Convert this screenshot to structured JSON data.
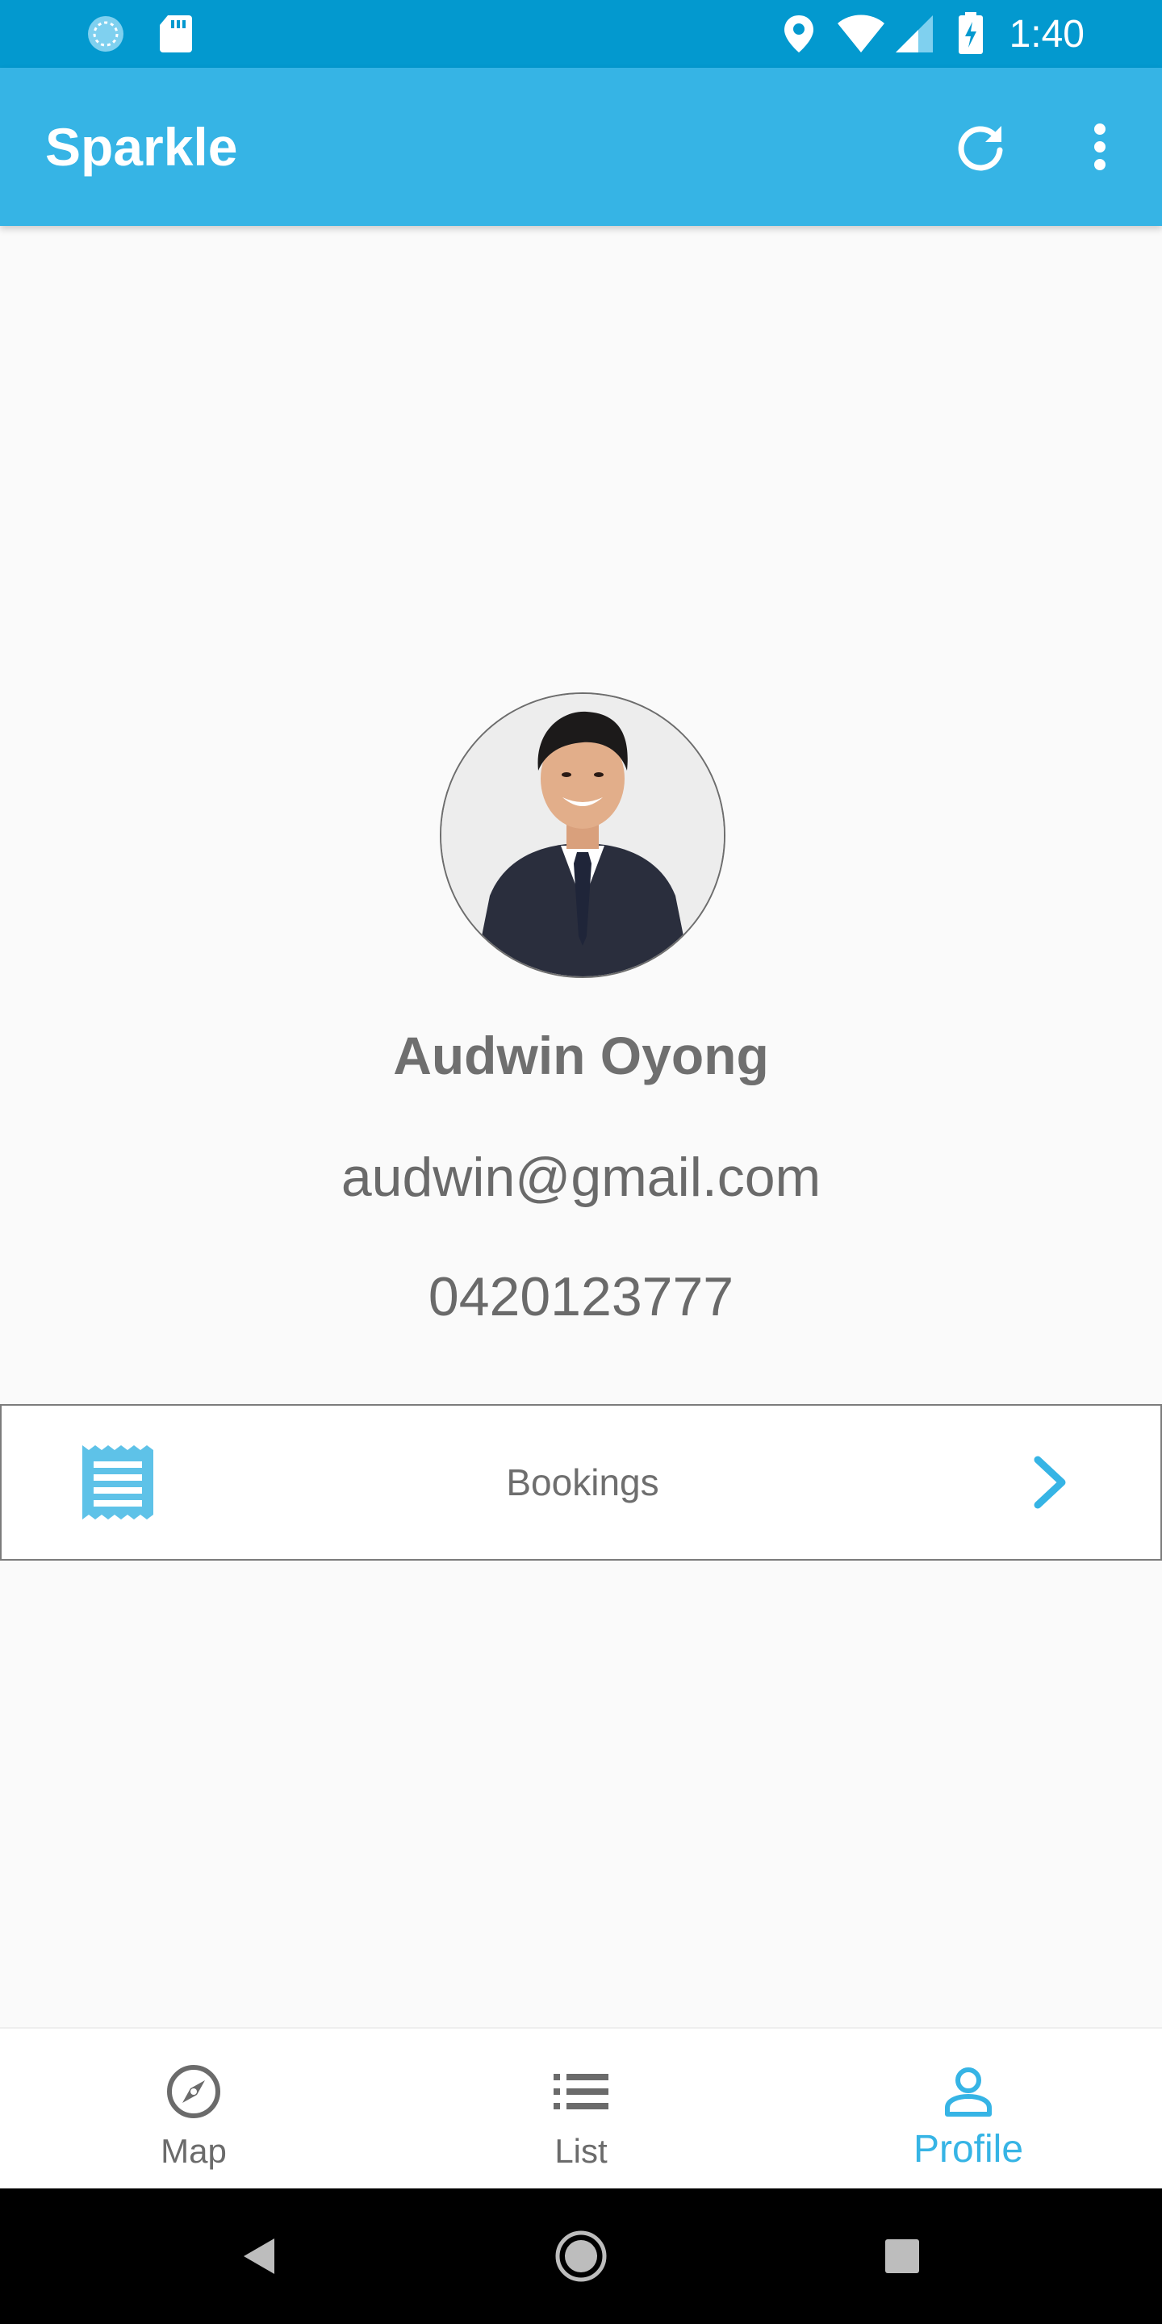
{
  "status_bar": {
    "time": "1:40",
    "left_icons": [
      "sync-icon",
      "sd-card-icon"
    ],
    "right_icons": [
      "location-icon",
      "wifi-icon",
      "signal-icon",
      "battery-charging-icon"
    ]
  },
  "app_bar": {
    "title": "Sparkle",
    "actions": [
      "refresh-icon",
      "more-vert-icon"
    ],
    "color": "#36b4e5"
  },
  "profile": {
    "name": "Audwin Oyong",
    "email": "audwin@gmail.com",
    "phone": "0420123777"
  },
  "bookings": {
    "label": "Bookings",
    "icon": "receipt-icon",
    "chevron": "chevron-right-icon"
  },
  "bottom_nav": {
    "items": [
      {
        "label": "Map",
        "icon": "compass-icon",
        "active": false
      },
      {
        "label": "List",
        "icon": "list-icon",
        "active": false
      },
      {
        "label": "Profile",
        "icon": "person-icon",
        "active": true
      }
    ],
    "active_color": "#36b4e5",
    "inactive_color": "#6b6b6b"
  },
  "system_nav": {
    "buttons": [
      "back-icon",
      "home-icon",
      "recents-icon"
    ]
  }
}
